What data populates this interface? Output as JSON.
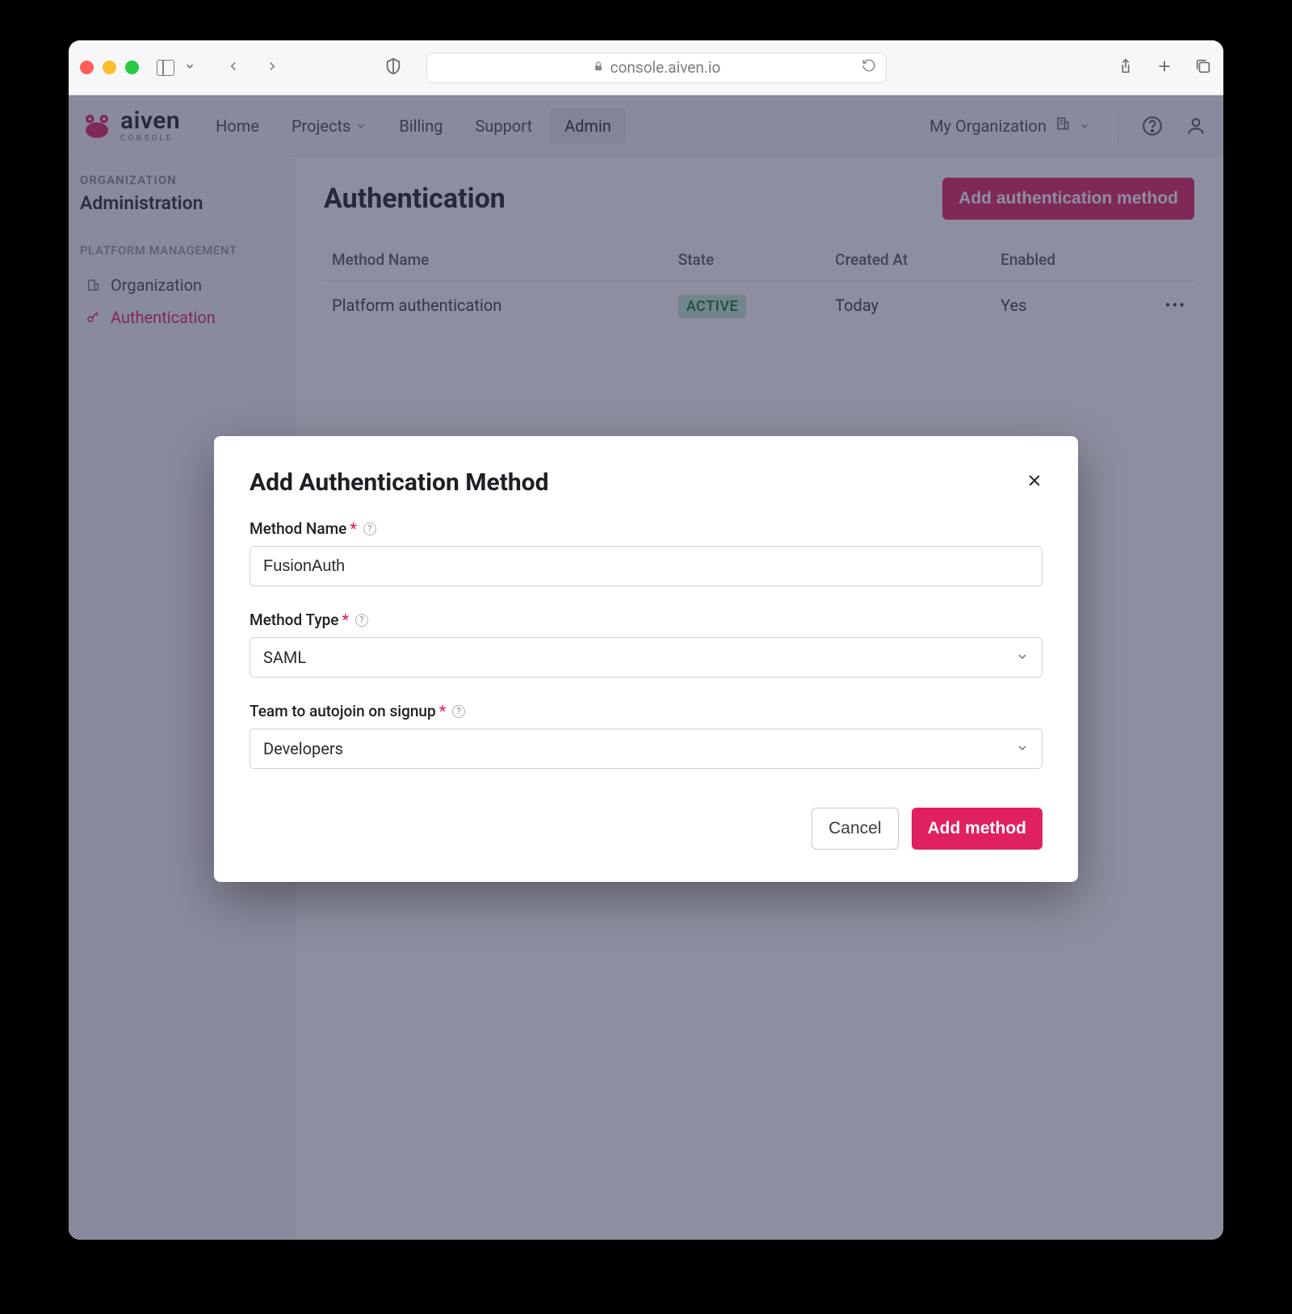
{
  "browser": {
    "url": "console.aiven.io"
  },
  "brand": {
    "name": "aiven",
    "sub": "CONSOLE"
  },
  "nav": {
    "home": "Home",
    "projects": "Projects",
    "billing": "Billing",
    "support": "Support",
    "admin": "Admin"
  },
  "header": {
    "org_label": "My Organization"
  },
  "sidebar": {
    "group_label": "ORGANIZATION",
    "group_title": "Administration",
    "section": "PLATFORM MANAGEMENT",
    "items": {
      "organization": "Organization",
      "authentication": "Authentication"
    }
  },
  "page": {
    "title": "Authentication",
    "add_btn": "Add authentication method"
  },
  "table": {
    "headers": {
      "method": "Method Name",
      "state": "State",
      "created": "Created At",
      "enabled": "Enabled"
    },
    "rows": [
      {
        "method": "Platform authentication",
        "state": "ACTIVE",
        "created": "Today",
        "enabled": "Yes"
      }
    ]
  },
  "modal": {
    "title": "Add Authentication Method",
    "fields": {
      "method_name": {
        "label": "Method Name",
        "value": "FusionAuth"
      },
      "method_type": {
        "label": "Method Type",
        "value": "SAML"
      },
      "team": {
        "label": "Team to autojoin on signup",
        "value": "Developers"
      }
    },
    "cancel": "Cancel",
    "submit": "Add method"
  }
}
